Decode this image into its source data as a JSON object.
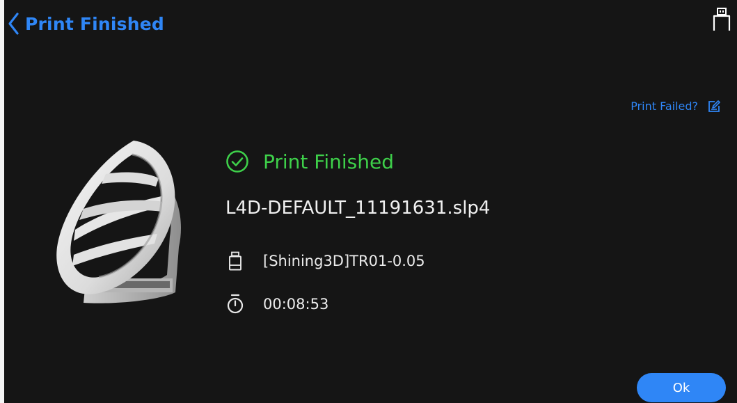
{
  "header": {
    "title": "Print Finished",
    "back_icon": "chevron-left-icon",
    "usb_icon": "usb-drive-icon"
  },
  "print_failed": {
    "label": "Print Failed?",
    "icon": "report-edit-icon"
  },
  "status": {
    "text": "Print Finished",
    "icon": "check-circle-icon",
    "color": "#3ed04a"
  },
  "job": {
    "file_name": "L4D-DEFAULT_11191631.slp4",
    "resin": "[Shining3D]TR01-0.05",
    "resin_icon": "resin-bottle-icon",
    "print_time": "00:08:53",
    "time_icon": "stopwatch-icon"
  },
  "actions": {
    "ok_label": "Ok"
  },
  "colors": {
    "accent": "#2f86f6",
    "background": "#151515",
    "success": "#3ed04a"
  }
}
